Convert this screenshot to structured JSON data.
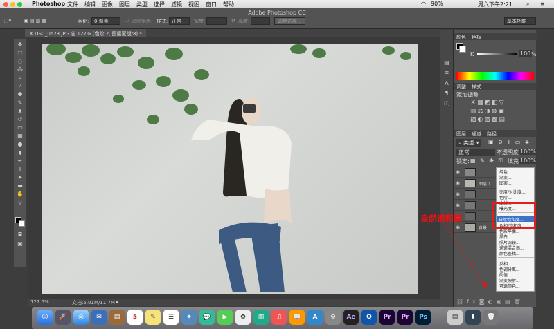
{
  "menubar": {
    "app": "Photoshop",
    "items": [
      "文件",
      "编辑",
      "图像",
      "图层",
      "类型",
      "选择",
      "滤镜",
      "视图",
      "窗口",
      "帮助"
    ],
    "status_right": {
      "battery": "90%",
      "clock": "周六下午2:21"
    }
  },
  "window_title": "Adobe Photoshop CC",
  "options": {
    "feather_label": "羽化:",
    "feather_value": "0 像素",
    "antialias": "消除锯齿",
    "style_label": "样式:",
    "style_value": "正常",
    "width_label": "宽度:",
    "height_label": "高度:",
    "refine_edge": "调整边缘...",
    "workspace": "基本功能"
  },
  "document_tab": "DSC_0623.JPG @ 127% (色阶 2, 图层蒙版/8) *",
  "status": {
    "zoom": "127.5%",
    "doc": "文档:5.01M/11.7M"
  },
  "right_panels": {
    "color_tabs": [
      "颜色",
      "色板"
    ],
    "k_label": "K",
    "k_value": "100",
    "k_unit": "%",
    "adjust_tabs": [
      "调整",
      "样式"
    ],
    "adjust_title": "添加调整",
    "layers_tabs": [
      "图层",
      "通道",
      "路径"
    ],
    "kind": "类型",
    "blend": "正常",
    "opacity_label": "不透明度:",
    "opacity_value": "100%",
    "lock_label": "锁定:",
    "fill_label": "填充:",
    "fill_value": "100%",
    "layer_names": [
      "",
      "图层 1",
      "",
      "",
      "",
      "",
      "背景"
    ]
  },
  "context_menu": {
    "items": [
      "纯色...",
      "渐变...",
      "图案...",
      "亮度/对比度...",
      "色阶...",
      "曲线...",
      "曝光度...",
      "自然饱和度...",
      "色相/饱和度...",
      "色彩平衡...",
      "黑白...",
      "照片滤镜...",
      "通道混合器...",
      "颜色查找...",
      "反相",
      "色调分离...",
      "阈值...",
      "渐变映射...",
      "可选颜色..."
    ],
    "highlighted": "自然饱和度..."
  },
  "annotation": "自然饱和度",
  "dock": {
    "labels": [
      "Ae",
      "Pr",
      "Pr",
      "Ps"
    ],
    "calendar_day": "5"
  }
}
